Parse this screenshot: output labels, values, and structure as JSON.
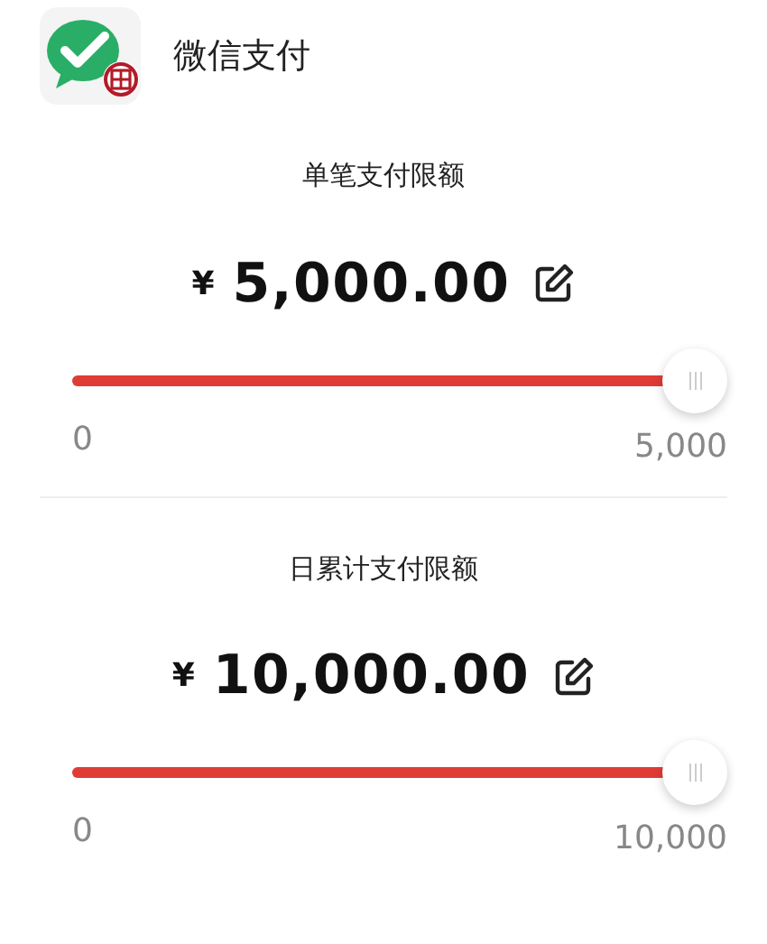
{
  "header": {
    "title": "微信支付"
  },
  "limits": [
    {
      "label": "单笔支付限额",
      "currency": "¥",
      "amount": "5,000.00",
      "slider": {
        "level": 1,
        "min": "0",
        "max": "5,000"
      }
    },
    {
      "label": "日累计支付限额",
      "currency": "¥",
      "amount": "10,000.00",
      "slider": {
        "level": 1,
        "min": "0",
        "max": "10,000"
      }
    }
  ]
}
